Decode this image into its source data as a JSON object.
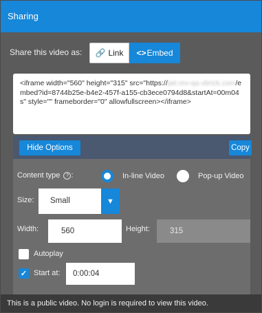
{
  "header": {
    "title": "Sharing"
  },
  "share": {
    "label": "Share this video as:",
    "tabs": [
      {
        "label": "Link",
        "icon": "link-icon",
        "selected": false
      },
      {
        "label": "Embed",
        "icon": "code-icon",
        "selected": true
      }
    ],
    "link_icon_glyph": "🔗",
    "embed_icon_glyph": "<>"
  },
  "embed_code": {
    "prefix": "<iframe width=\"560\" height=\"315\" src=\"https://",
    "blurred_host": "jwt.rev-qa.vbrick.com",
    "suffix": "/embed?id=8744b25e-b4e2-457f-a155-cb3ece0794d8&startAt=00m04s\" style=\"\" frameborder=\"0\" allowfullscreen></iframe>"
  },
  "buttons": {
    "hide_options": "Hide Options",
    "copy": "Copy"
  },
  "options": {
    "content_type_label": "Content type",
    "content_type_suffix": ":",
    "info_glyph": "?",
    "inline_label": "In-line Video",
    "popup_label": "Pop-up Video",
    "content_type_selected": "In-line Video",
    "size_label": "Size:",
    "size_value": "Small",
    "size_arrow": "▼",
    "width_label": "Width:",
    "width_value": "560",
    "height_label": "Height:",
    "height_value": "315",
    "autoplay_label": "Autoplay",
    "autoplay_checked": false,
    "start_at_label": "Start at:",
    "start_at_checked": true,
    "start_at_value": "0:00:04",
    "check_glyph": "✓"
  },
  "footer": {
    "text": "This is a public video. No login is required to view this video."
  },
  "colors": {
    "accent": "#1687d9",
    "panel": "#5b5b5b",
    "options_bar": "#4a5870"
  }
}
